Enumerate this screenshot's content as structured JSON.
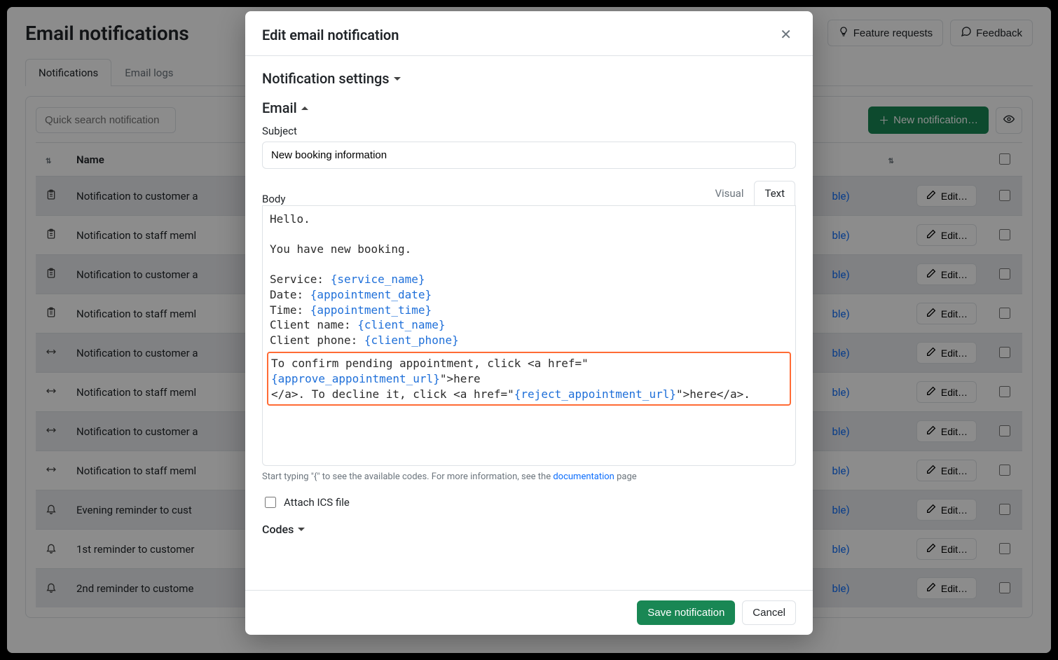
{
  "page": {
    "title": "Email notifications"
  },
  "header_buttons": {
    "feature_requests": "Feature requests",
    "feedback": "Feedback"
  },
  "tabs": [
    "Notifications",
    "Email logs"
  ],
  "active_tab_index": 0,
  "toolbar": {
    "search_placeholder": "Quick search notification",
    "new_notification": "New notification…"
  },
  "table": {
    "columns": {
      "name": "Name",
      "edit": "Edit…"
    },
    "rows": [
      {
        "icon": "clipboard",
        "name": "Notification to customer a",
        "suffix": "ble)"
      },
      {
        "icon": "clipboard",
        "name": "Notification to staff meml",
        "suffix": "ble)"
      },
      {
        "icon": "clipboard",
        "name": "Notification to customer a",
        "suffix": "ble)"
      },
      {
        "icon": "clipboard",
        "name": "Notification to staff meml",
        "suffix": "ble)"
      },
      {
        "icon": "arrows",
        "name": "Notification to customer a",
        "suffix": "ble)"
      },
      {
        "icon": "arrows",
        "name": "Notification to staff meml",
        "suffix": "ble)"
      },
      {
        "icon": "arrows",
        "name": "Notification to customer a",
        "suffix": "ble)"
      },
      {
        "icon": "arrows",
        "name": "Notification to staff meml",
        "suffix": "ble)"
      },
      {
        "icon": "bell",
        "name": "Evening reminder to cust",
        "suffix": "ble)"
      },
      {
        "icon": "bell",
        "name": "1st reminder to customer",
        "suffix": "ble)"
      },
      {
        "icon": "bell",
        "name": "2nd reminder to custome",
        "suffix": "ble)"
      }
    ]
  },
  "modal": {
    "title": "Edit email notification",
    "section_settings": "Notification settings",
    "section_email": "Email",
    "subject_label": "Subject",
    "subject_value": "New booking information",
    "body_label": "Body",
    "body_tabs": {
      "visual": "Visual",
      "text": "Text"
    },
    "body_lines": {
      "l1": "Hello.",
      "l2": "",
      "l3": "You have new booking.",
      "l4": "",
      "l5a": "Service: ",
      "l5b": "{service_name}",
      "l6a": "Date: ",
      "l6b": "{appointment_date}",
      "l7a": "Time: ",
      "l7b": "{appointment_time}",
      "l8a": "Client name: ",
      "l8b": "{client_name}",
      "l9a": "Client phone: ",
      "l9b": "{client_phone}",
      "h1a": "To confirm pending appointment, click <a href=\"",
      "h1b": "{approve_appointment_url}",
      "h1c": "\">here",
      "h2a": "</a>. To decline it, click <a href=\"",
      "h2b": "{reject_appointment_url}",
      "h2c": "\">here</a>."
    },
    "hint_prefix": "Start typing \"{\" to see the available codes. For more information, see the ",
    "hint_link": "documentation",
    "hint_suffix": " page",
    "attach_label": "Attach ICS file",
    "codes_label": "Codes",
    "save": "Save notification",
    "cancel": "Cancel"
  },
  "icons": {
    "lightbulb": "lightbulb-icon",
    "chat": "chat-icon",
    "eye": "eye-icon",
    "plus": "plus-icon",
    "edit": "edit-icon"
  }
}
